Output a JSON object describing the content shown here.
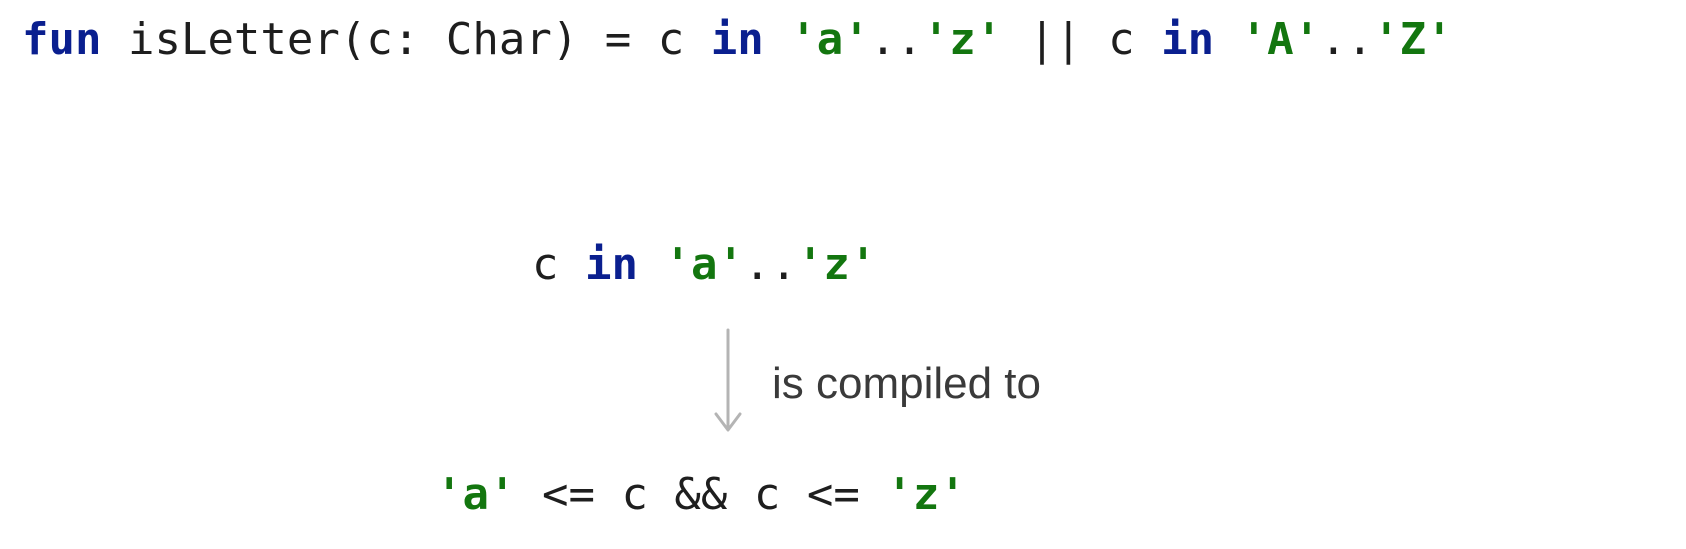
{
  "top_line": {
    "tokens": [
      {
        "text": "fun",
        "kind": "keyword"
      },
      {
        "text": " isLetter(c: Char) = c ",
        "kind": "plain"
      },
      {
        "text": "in",
        "kind": "keyword"
      },
      {
        "text": " ",
        "kind": "plain"
      },
      {
        "text": "'a'",
        "kind": "string"
      },
      {
        "text": "..",
        "kind": "plain"
      },
      {
        "text": "'z'",
        "kind": "string"
      },
      {
        "text": " || c ",
        "kind": "plain"
      },
      {
        "text": "in",
        "kind": "keyword"
      },
      {
        "text": " ",
        "kind": "plain"
      },
      {
        "text": "'A'",
        "kind": "string"
      },
      {
        "text": "..",
        "kind": "plain"
      },
      {
        "text": "'Z'",
        "kind": "string"
      }
    ]
  },
  "middle_line": {
    "tokens": [
      {
        "text": "c ",
        "kind": "plain"
      },
      {
        "text": "in",
        "kind": "keyword"
      },
      {
        "text": " ",
        "kind": "plain"
      },
      {
        "text": "'a'",
        "kind": "string"
      },
      {
        "text": "..",
        "kind": "plain"
      },
      {
        "text": "'z'",
        "kind": "string"
      }
    ]
  },
  "arrow_label": "is compiled to",
  "bottom_line": {
    "tokens": [
      {
        "text": "'a'",
        "kind": "string"
      },
      {
        "text": " <= c && c <= ",
        "kind": "plain"
      },
      {
        "text": "'z'",
        "kind": "string"
      }
    ]
  },
  "colors": {
    "keyword": "#0a1f8f",
    "string": "#13760f",
    "plain": "#1e1e1e",
    "arrow": "#b4b4b4"
  },
  "icons": {
    "arrow": "down-arrow-icon"
  }
}
